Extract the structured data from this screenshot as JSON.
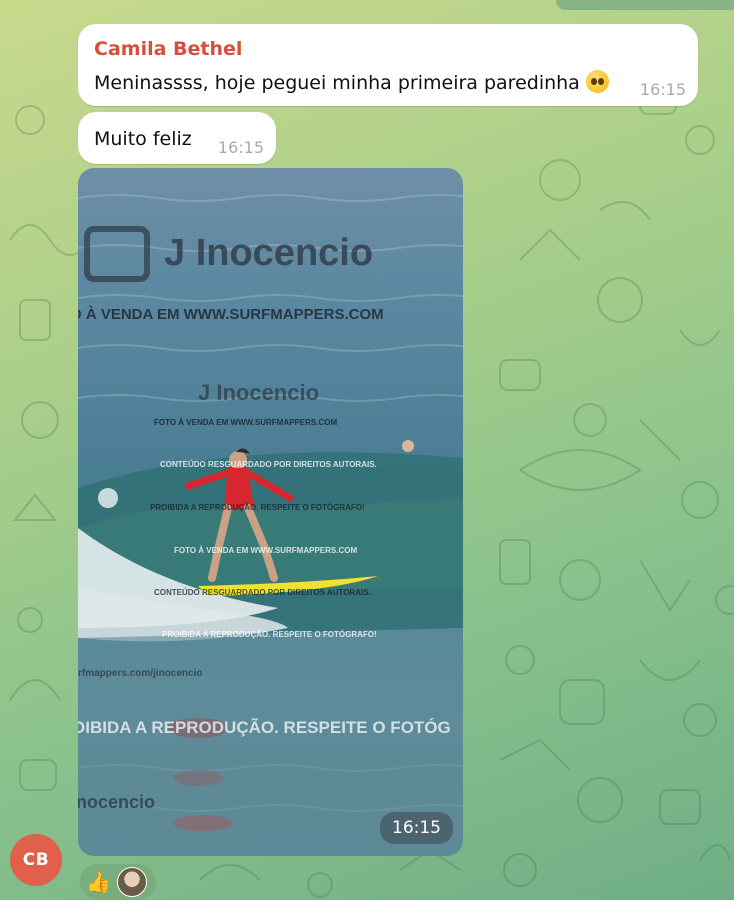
{
  "messages": [
    {
      "sender": "Camila Bethel",
      "text": "Meninassss, hoje peguei minha primeira paredinha",
      "time": "16:15"
    },
    {
      "text": "Muito feliz",
      "time": "16:15"
    }
  ],
  "photo": {
    "time": "16:15",
    "watermarks": {
      "brand_large": "J Inocencio",
      "sale_large": "O À VENDA EM WWW.SURFMAPPERS.COM",
      "brand_mid": "J Inocencio",
      "sale_small": "FOTO À VENDA EM WWW.SURFMAPPERS.COM",
      "content_rights": "CONTEÚDO RESGUARDADO POR DIREITOS AUTORAIS.",
      "prohibited": "PROIBIDA A REPRODUÇÃO. RESPEITE O FOTÓGRAFO!",
      "sale_small_2": "FOTO À VENDA EM WWW.SURFMAPPERS.COM",
      "content_rights_2": "CONTEÚDO RESGUARDADO POR DIREITOS AUTORAIS.",
      "prohibited_2": "PROIBIDA A REPRODUÇÃO. RESPEITE O FOTÓGRAFO!",
      "url": "rfmappers.com/jinocencio",
      "prohibited_large": "OIBIDA A REPRODUÇÃO. RESPEITE O FOTÓG",
      "brand_bottom": "nocencio"
    }
  },
  "avatar_initials": "CB",
  "reaction": {
    "emoji": "👍"
  },
  "colors": {
    "sender_name": "#d4503c",
    "avatar": "#e0604c",
    "bubble": "#ffffff"
  }
}
